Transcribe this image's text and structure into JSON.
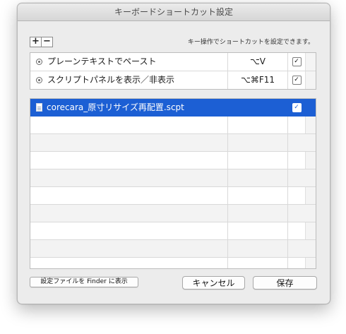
{
  "window": {
    "title": "キーボードショートカット設定"
  },
  "toolbar": {
    "add_label": "+",
    "remove_label": "−",
    "hint": "キー操作でショートカットを設定できます。"
  },
  "builtin_shortcuts": [
    {
      "name": "プレーンテキストでペースト",
      "key": "⌥V",
      "checked": "✓",
      "icon": "clock-icon"
    },
    {
      "name": "スクリプトパネルを表示／非表示",
      "key": "⌥⌘F11",
      "checked": "✓",
      "icon": "clock-icon"
    }
  ],
  "script_shortcuts": [
    {
      "name": "corecara_原寸リサイズ再配置.scpt",
      "key": "",
      "checked": "✓",
      "selected": true,
      "icon": "script-file-icon"
    }
  ],
  "buttons": {
    "reveal_in_finder": "設定ファイルを Finder に表示",
    "cancel": "キャンセル",
    "save": "保存"
  },
  "colors": {
    "selection": "#1c5fd4",
    "window_bg": "#ececec"
  }
}
